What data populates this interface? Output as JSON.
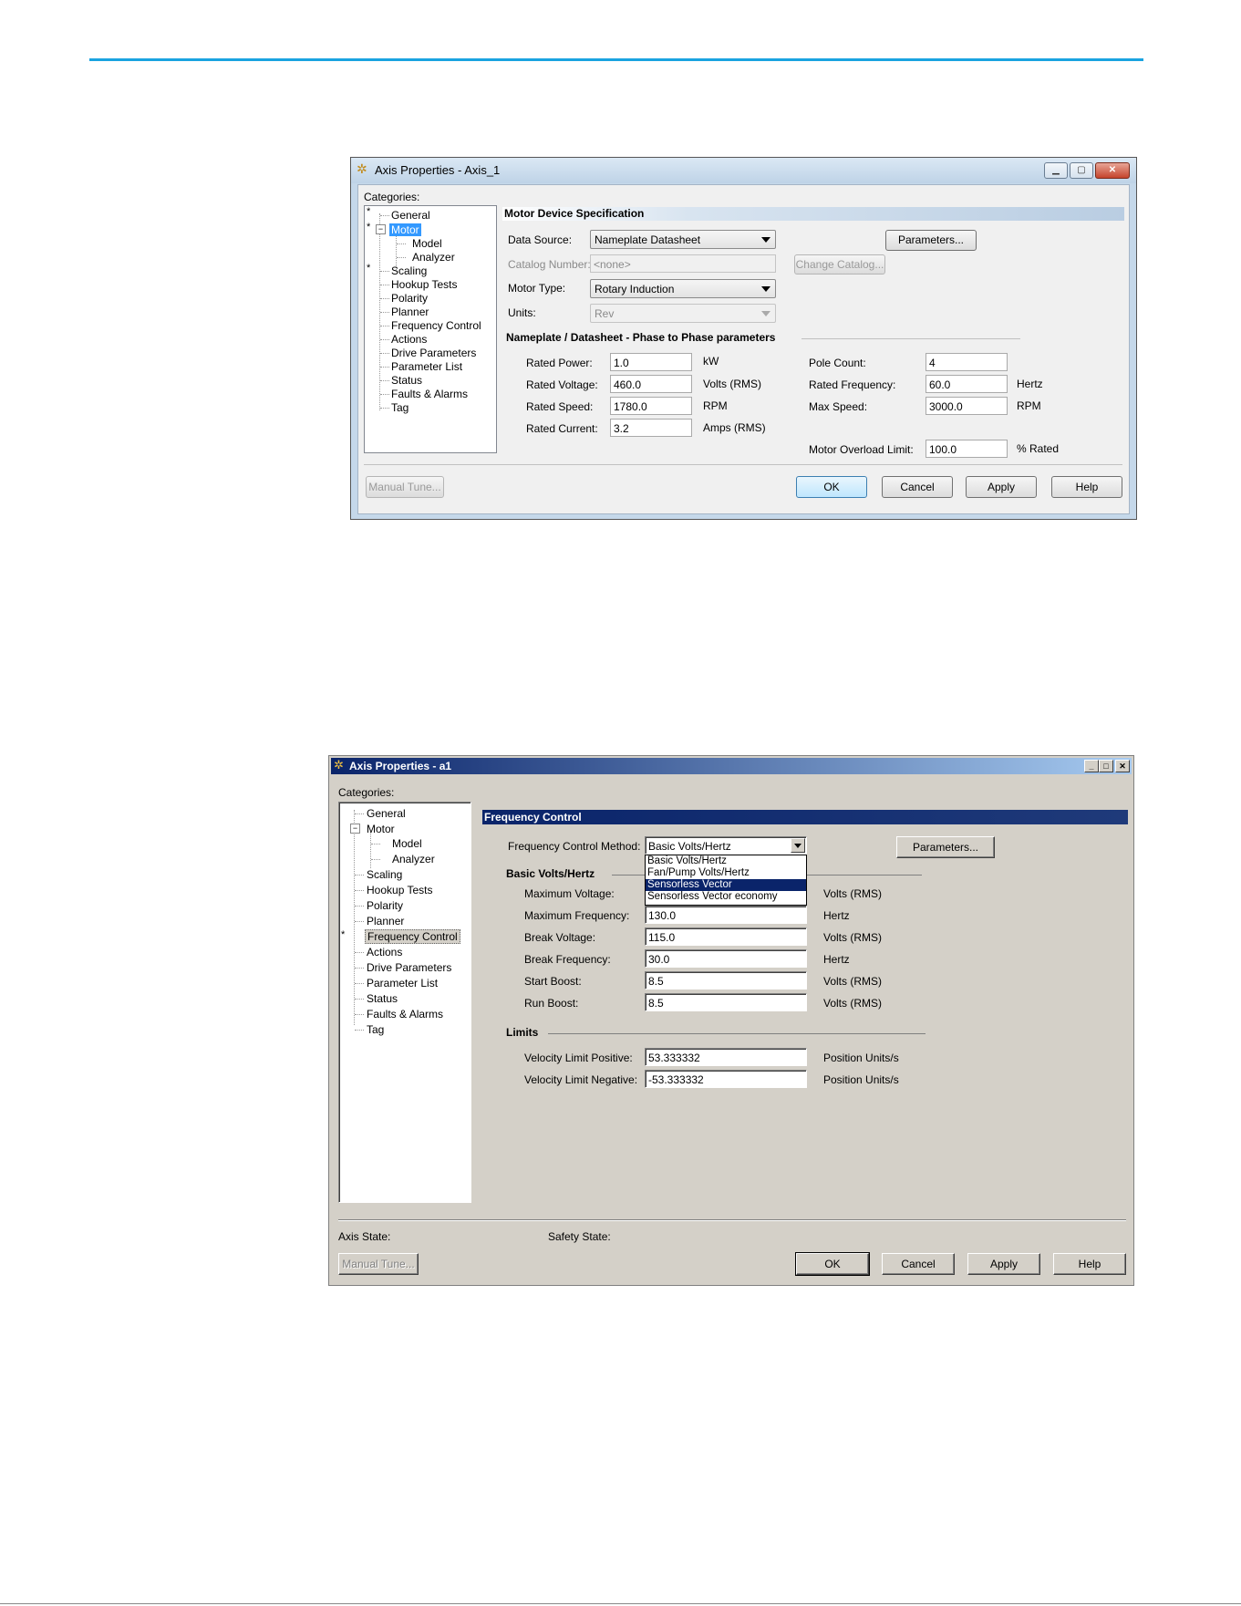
{
  "window1": {
    "title": "Axis Properties - Axis_1",
    "categories_label": "Categories:",
    "tree": [
      "General",
      "Motor",
      "Model",
      "Analyzer",
      "Scaling",
      "Hookup Tests",
      "Polarity",
      "Planner",
      "Frequency Control",
      "Actions",
      "Drive Parameters",
      "Parameter List",
      "Status",
      "Faults & Alarms",
      "Tag"
    ],
    "section_title": "Motor Device Specification",
    "data_source_label": "Data Source:",
    "data_source_value": "Nameplate Datasheet",
    "parameters_button": "Parameters...",
    "catalog_label": "Catalog Number:",
    "catalog_value": "<none>",
    "change_catalog_button": "Change Catalog...",
    "motor_type_label": "Motor Type:",
    "motor_type_value": "Rotary Induction",
    "units_label": "Units:",
    "units_value": "Rev",
    "group_title": "Nameplate / Datasheet - Phase to Phase parameters",
    "rated_power_label": "Rated Power:",
    "rated_power_value": "1.0",
    "rated_power_unit": "kW",
    "rated_voltage_label": "Rated Voltage:",
    "rated_voltage_value": "460.0",
    "rated_voltage_unit": "Volts (RMS)",
    "rated_speed_label": "Rated Speed:",
    "rated_speed_value": "1780.0",
    "rated_speed_unit": "RPM",
    "rated_current_label": "Rated Current:",
    "rated_current_value": "3.2",
    "rated_current_unit": "Amps (RMS)",
    "pole_count_label": "Pole Count:",
    "pole_count_value": "4",
    "rated_frequency_label": "Rated Frequency:",
    "rated_frequency_value": "60.0",
    "rated_frequency_unit": "Hertz",
    "max_speed_label": "Max Speed:",
    "max_speed_value": "3000.0",
    "max_speed_unit": "RPM",
    "overload_label": "Motor Overload Limit:",
    "overload_value": "100.0",
    "overload_unit": "% Rated",
    "manual_tune_button": "Manual Tune...",
    "ok_button": "OK",
    "cancel_button": "Cancel",
    "apply_button": "Apply",
    "help_button": "Help"
  },
  "window2": {
    "title": "Axis Properties - a1",
    "categories_label": "Categories:",
    "tree": [
      "General",
      "Motor",
      "Model",
      "Analyzer",
      "Scaling",
      "Hookup Tests",
      "Polarity",
      "Planner",
      "Frequency Control",
      "Actions",
      "Drive Parameters",
      "Parameter List",
      "Status",
      "Faults & Alarms",
      "Tag"
    ],
    "section_title": "Frequency Control",
    "method_label": "Frequency Control Method:",
    "method_value": "Basic Volts/Hertz",
    "method_options": [
      "Basic Volts/Hertz",
      "Fan/Pump Volts/Hertz",
      "Sensorless Vector",
      "Sensorless Vector economy"
    ],
    "parameters_button": "Parameters...",
    "group_title": "Basic Volts/Hertz",
    "max_voltage_label": "Maximum Voltage:",
    "max_voltage_unit": "Volts (RMS)",
    "max_frequency_label": "Maximum Frequency:",
    "max_frequency_value": "130.0",
    "max_frequency_unit": "Hertz",
    "break_voltage_label": "Break Voltage:",
    "break_voltage_value": "115.0",
    "break_voltage_unit": "Volts (RMS)",
    "break_frequency_label": "Break Frequency:",
    "break_frequency_value": "30.0",
    "break_frequency_unit": "Hertz",
    "start_boost_label": "Start Boost:",
    "start_boost_value": "8.5",
    "start_boost_unit": "Volts (RMS)",
    "run_boost_label": "Run Boost:",
    "run_boost_value": "8.5",
    "run_boost_unit": "Volts (RMS)",
    "limits_title": "Limits",
    "vel_pos_label": "Velocity Limit Positive:",
    "vel_pos_value": "53.333332",
    "vel_pos_unit": "Position Units/s",
    "vel_neg_label": "Velocity Limit Negative:",
    "vel_neg_value": "-53.333332",
    "vel_neg_unit": "Position Units/s",
    "axis_state_label": "Axis State:",
    "safety_state_label": "Safety State:",
    "manual_tune_button": "Manual Tune...",
    "ok_button": "OK",
    "cancel_button": "Cancel",
    "apply_button": "Apply",
    "help_button": "Help"
  }
}
